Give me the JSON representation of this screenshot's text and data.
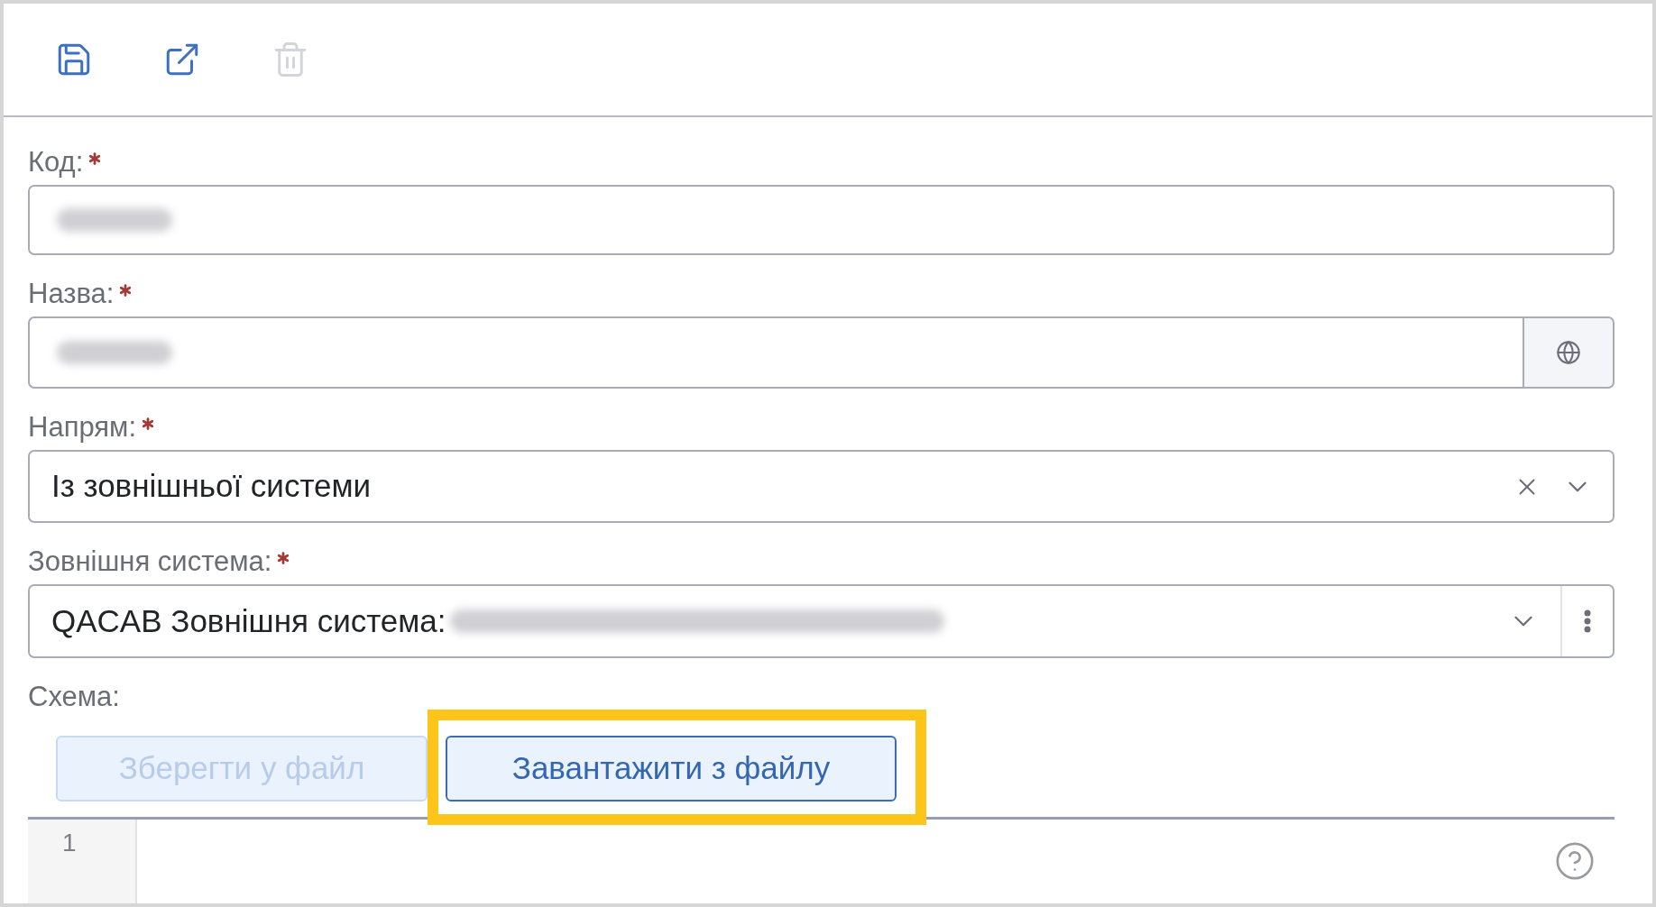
{
  "toolbar": {
    "tools": [
      {
        "kind": "save",
        "disabled": false
      },
      {
        "kind": "open-external",
        "disabled": false
      },
      {
        "kind": "delete",
        "disabled": true
      }
    ]
  },
  "form": {
    "fields": [
      {
        "kind": "text",
        "label": "Код:",
        "required": true,
        "value_redacted": true
      },
      {
        "kind": "translatable",
        "label": "Назва:",
        "required": true,
        "value_redacted": true
      },
      {
        "kind": "select",
        "label": "Напрям:",
        "required": true,
        "value": "Із зовнішньої системи",
        "clearable": true
      },
      {
        "kind": "select-menu",
        "label": "Зовнішня система:",
        "required": true,
        "value": "QACAB Зовнішня система:",
        "value_redacted": true
      }
    ]
  },
  "schema": {
    "label": "Схема:",
    "buttons": [
      {
        "label": "Зберегти у файл",
        "disabled": true,
        "highlighted": false
      },
      {
        "label": "Завантажити з файлу",
        "disabled": false,
        "highlighted": true
      }
    ],
    "editor": {
      "line_numbers": [
        "1"
      ]
    }
  }
}
